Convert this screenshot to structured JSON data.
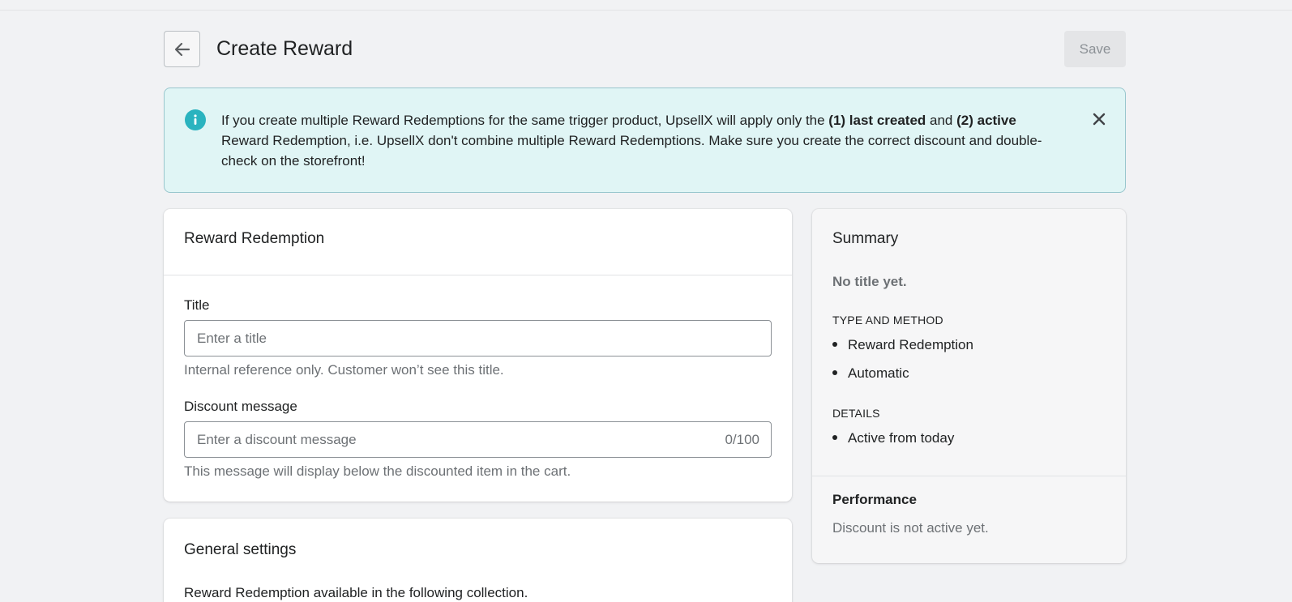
{
  "header": {
    "title": "Create Reward",
    "save_label": "Save"
  },
  "banner": {
    "text_part1": "If you create multiple Reward Redemptions for the same trigger product, UpsellX will apply only the ",
    "bold1": "(1) last created",
    "text_part2": " and ",
    "bold2": "(2) active",
    "text_part3": " Reward Redemption, i.e. UpsellX don't combine multiple Reward Redemptions. Make sure you create the correct discount and double-check on the storefront!",
    "color": "#e0f5f5",
    "icon_color": "#2ab3bf"
  },
  "reward_redemption": {
    "card_title": "Reward Redemption",
    "title_label": "Title",
    "title_placeholder": "Enter a title",
    "title_value": "",
    "title_help": "Internal reference only. Customer won’t see this title.",
    "discount_label": "Discount message",
    "discount_placeholder": "Enter a discount message",
    "discount_value": "",
    "discount_counter": "0/100",
    "discount_help": "This message will display below the discounted item in the cart."
  },
  "general_settings": {
    "card_title": "General settings",
    "description": "Reward Redemption available in the following collection."
  },
  "summary": {
    "card_title": "Summary",
    "no_title": "No title yet.",
    "type_heading": "TYPE AND METHOD",
    "type_items": [
      "Reward Redemption",
      "Automatic"
    ],
    "details_heading": "DETAILS",
    "details_items": [
      "Active from today"
    ],
    "performance_title": "Performance",
    "performance_text": "Discount is not active yet."
  }
}
